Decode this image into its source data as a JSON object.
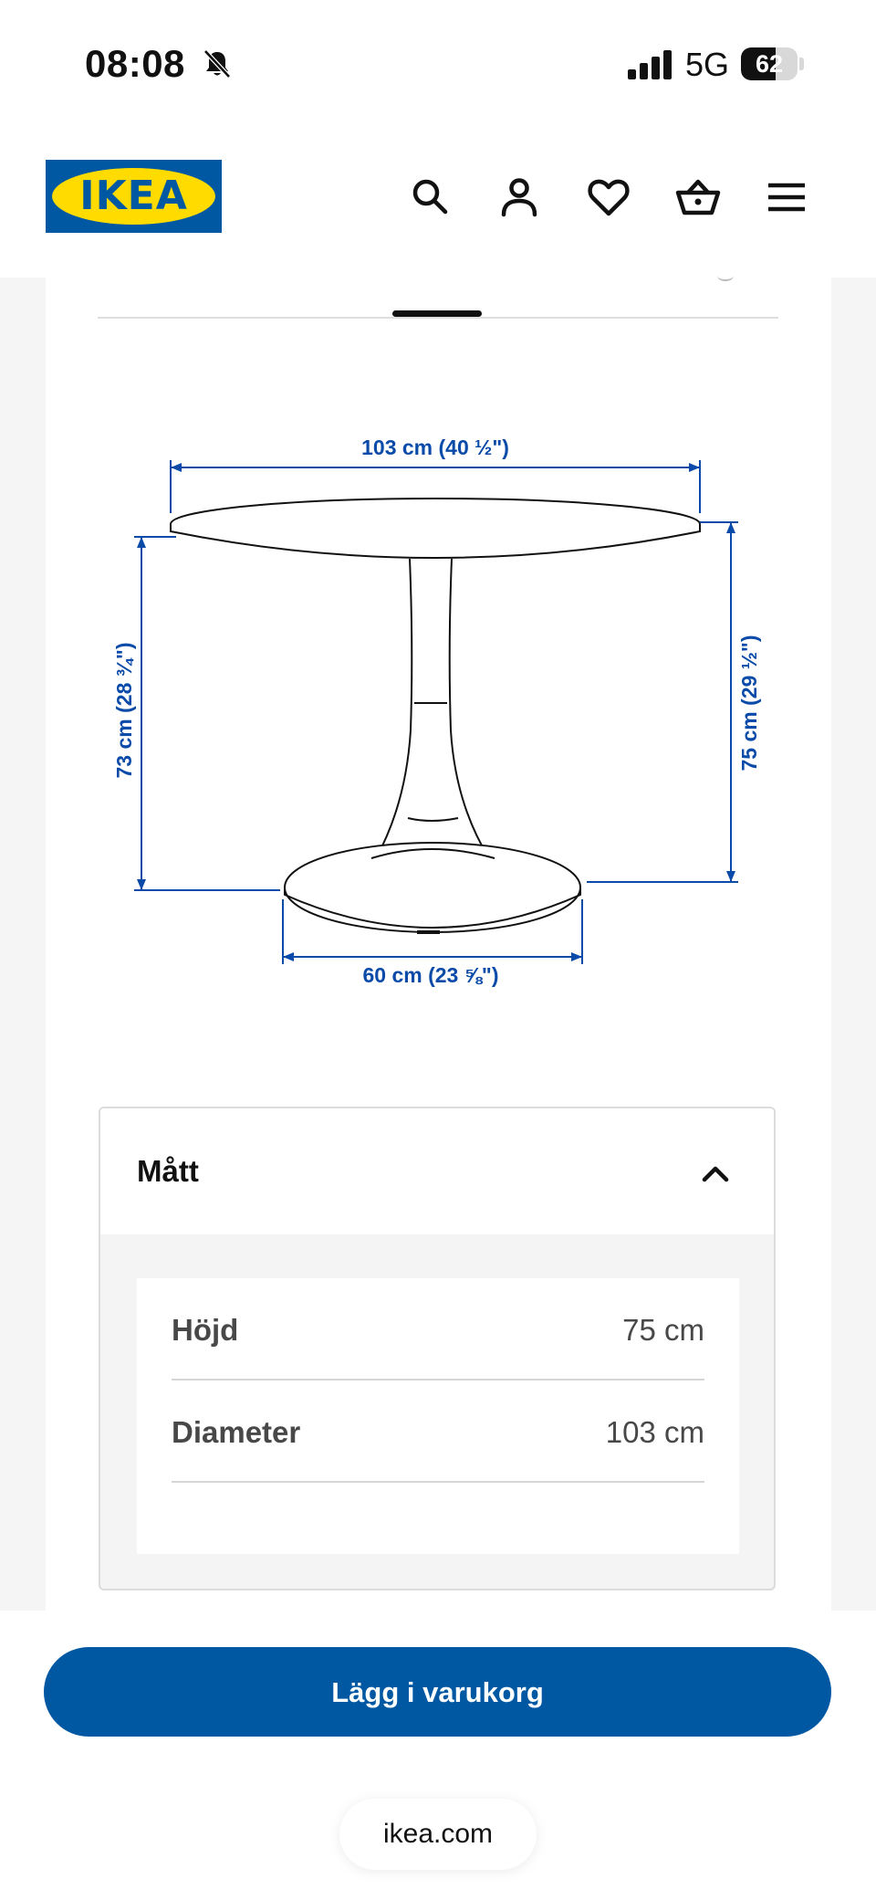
{
  "status_bar": {
    "time": "08:08",
    "silent_icon": "bell-slash-icon",
    "signal_icon": "cellular-signal-icon",
    "network": "5G",
    "battery_percent": "62",
    "battery_level": 0.62
  },
  "header": {
    "logo_text": "IKEA",
    "brand_blue": "#0058a3",
    "brand_yellow": "#ffdb00",
    "icons": [
      "search-icon",
      "account-icon",
      "heart-icon",
      "basket-icon",
      "menu-icon"
    ]
  },
  "diagram": {
    "line_color": "#0a4aa8",
    "top_width_label": "103 cm (40 ½\")",
    "left_height_label": "73 cm (28 ¾\")",
    "right_height_label": "75 cm (29 ½\")",
    "base_width_label": "60 cm (23 ⅝\")"
  },
  "accordion": {
    "title": "Mått",
    "rows": [
      {
        "label": "Höjd",
        "value": "75 cm"
      },
      {
        "label": "Diameter",
        "value": "103 cm"
      }
    ]
  },
  "cta": {
    "label": "Lägg i varukorg"
  },
  "browser": {
    "url": "ikea.com"
  }
}
